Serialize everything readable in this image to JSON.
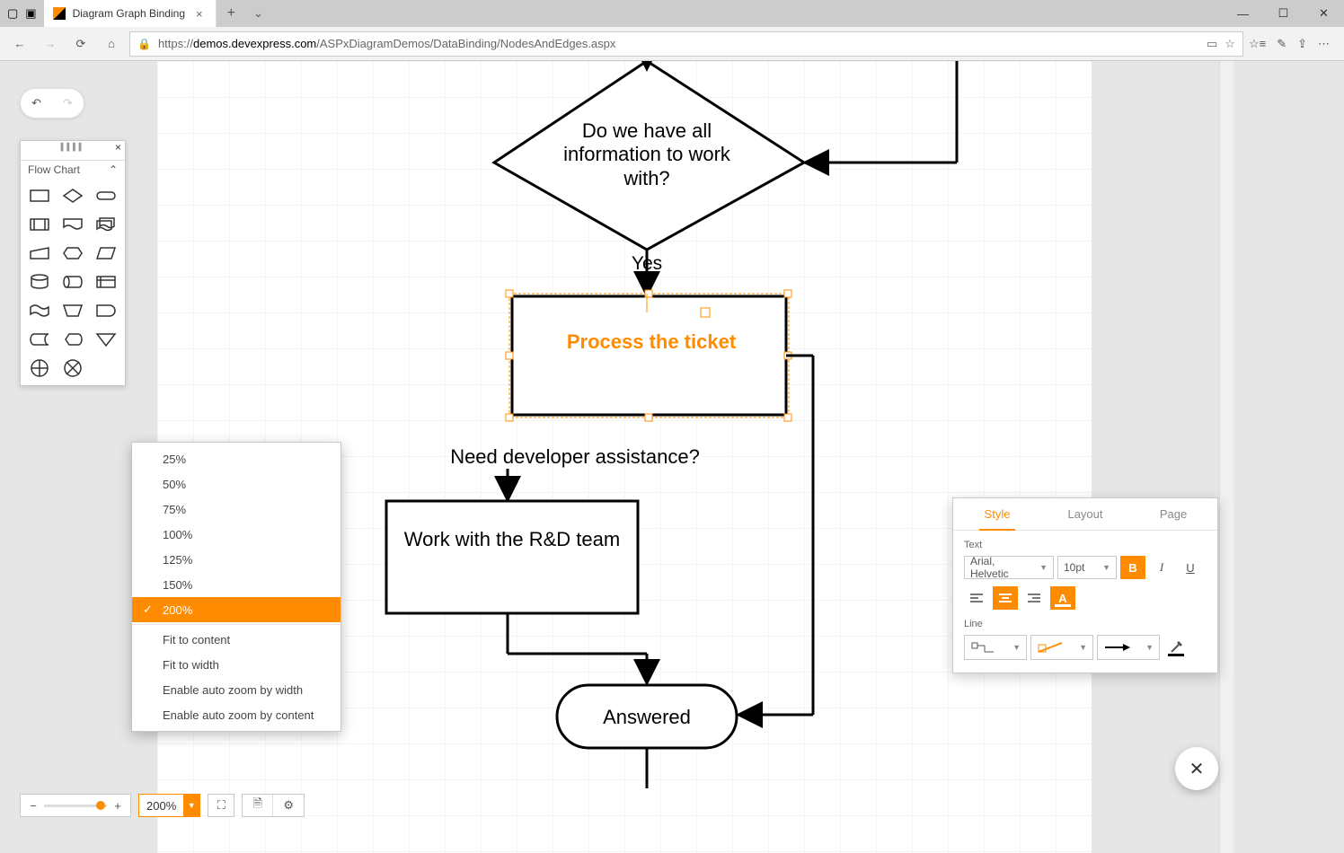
{
  "browser": {
    "tab_title": "Diagram Graph Binding",
    "url_prefix": "https://",
    "url_domain": "demos.devexpress.com",
    "url_path": "/ASPxDiagramDemos/DataBinding/NodesAndEdges.aspx"
  },
  "shape_panel": {
    "title": "Flow Chart"
  },
  "diagram": {
    "decision_text": "Do we have all information to work with?",
    "edge_yes": "Yes",
    "process_text": "Process the ticket",
    "question2": "Need developer assistance?",
    "work_rd": "Work with the R&D team",
    "answered": "Answered"
  },
  "zoom_menu": {
    "items": [
      "25%",
      "50%",
      "75%",
      "100%",
      "125%",
      "150%",
      "200%",
      "Fit to content",
      "Fit to width",
      "Enable auto zoom by width",
      "Enable auto zoom by content"
    ],
    "selected": "200%"
  },
  "bottom_bar": {
    "zoom_value": "200%"
  },
  "props": {
    "tabs": [
      "Style",
      "Layout",
      "Page"
    ],
    "text_label": "Text",
    "font_family": "Arial, Helvetic",
    "font_size": "10pt",
    "line_label": "Line"
  }
}
